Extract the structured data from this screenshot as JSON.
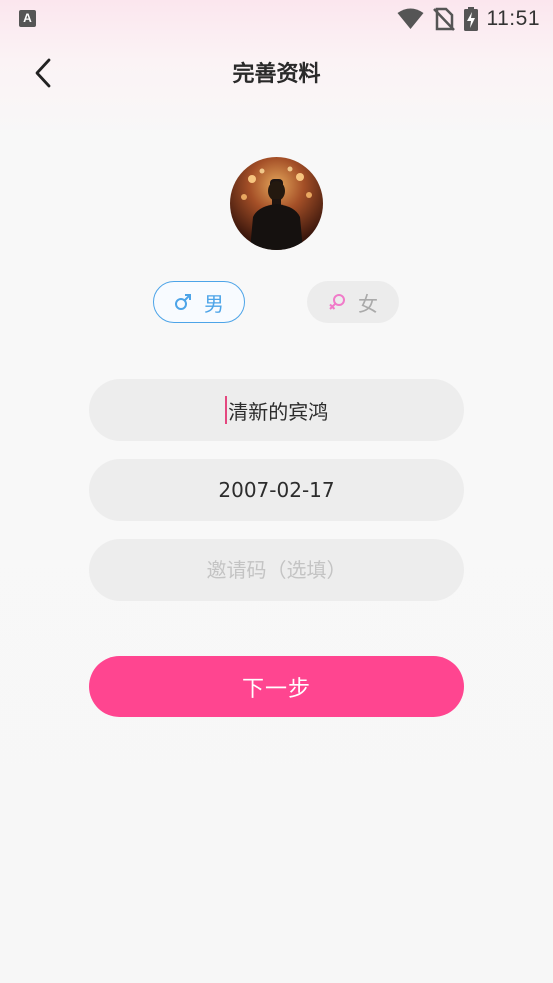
{
  "status_bar": {
    "app_icon_letter": "A",
    "time": "11:51",
    "icons": [
      "wifi-icon",
      "no-sim-icon",
      "battery-charging-icon"
    ]
  },
  "header": {
    "title": "完善资料",
    "back_icon": "chevron-left-icon"
  },
  "profile": {
    "avatar_alt": "avatar"
  },
  "gender": {
    "male_label": "男",
    "female_label": "女",
    "selected": "male",
    "male_color": "#4da4e8",
    "female_symbol_color": "#f07bc9"
  },
  "form": {
    "nickname_value": "清新的宾鸿",
    "birthday_value": "2007-02-17",
    "invite_placeholder": "邀请码（选填）",
    "invite_value": ""
  },
  "actions": {
    "next_label": "下一步",
    "accent_color": "#ff4590"
  }
}
